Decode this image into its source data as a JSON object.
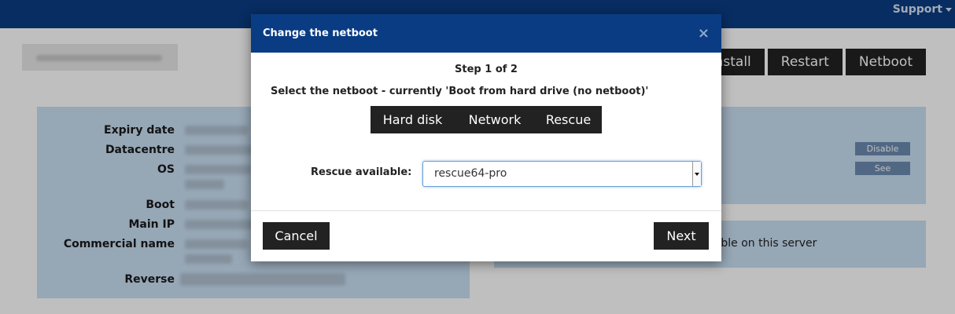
{
  "topbar": {
    "support_label": "Support"
  },
  "actions": {
    "reinstall_label": "einstall",
    "restart_label": "Restart",
    "netboot_label": "Netboot"
  },
  "details": {
    "labels": [
      "Expiry date",
      "Datacentre",
      "OS",
      "Boot",
      "Main IP",
      "Commercial name",
      "Reverse"
    ]
  },
  "right_panel": {
    "disable_label": "Disable",
    "see_label": "See",
    "notice_text": "ilable on this server"
  },
  "modal": {
    "title": "Change the netboot",
    "close_glyph": "×",
    "step": "Step 1 of 2",
    "select_text": "Select the netboot - currently 'Boot from hard drive (no netboot)'",
    "options": [
      "Hard disk",
      "Network",
      "Rescue"
    ],
    "selected_option": "Rescue",
    "rescue_label": "Rescue available:",
    "rescue_value": "rescue64-pro",
    "cancel_label": "Cancel",
    "next_label": "Next"
  },
  "colors": {
    "brand": "#0a3c83",
    "panel": "#c9dff3",
    "button": "#222222"
  },
  "icons": {
    "close": "close-icon",
    "dropdown": "chevron-down-icon"
  }
}
